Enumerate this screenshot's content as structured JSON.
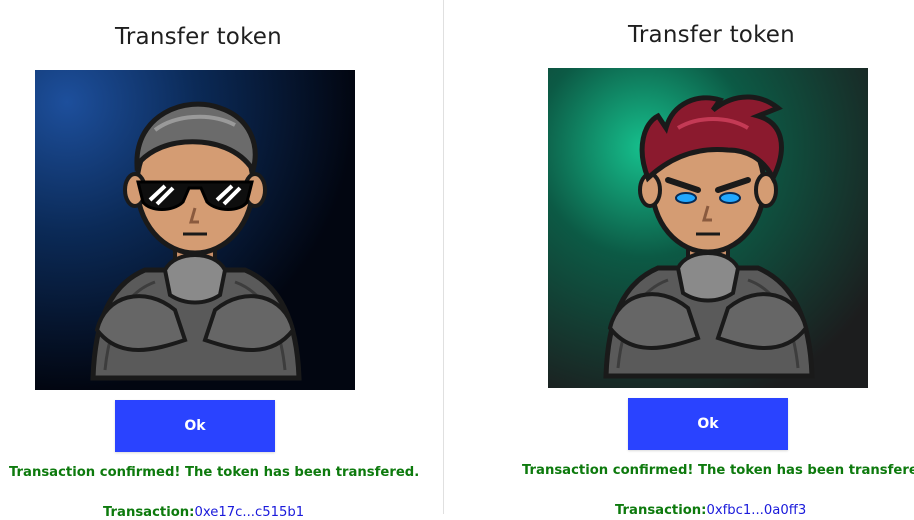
{
  "colors": {
    "button_bg": "#2a43ff",
    "button_text": "#ffffff",
    "success_text": "#0d7a0d",
    "tx_label": "#0d7a0d",
    "tx_link": "#1a1adb",
    "title_text": "#1f1f1f"
  },
  "left": {
    "title": "Transfer token",
    "image_icon": "avatar-sunglasses-character",
    "ok_label": "Ok",
    "status_text": "Transaction confirmed! The token has been transfered.",
    "tx_label": "Transaction:",
    "tx_hash": "0xe17c...c515b1"
  },
  "right": {
    "title": "Transfer token",
    "image_icon": "avatar-red-hair-character",
    "ok_label": "Ok",
    "status_text": "Transaction confirmed! The token has been transfered.",
    "tx_label": "Transaction:",
    "tx_hash": "0xfbc1...0a0ff3"
  }
}
